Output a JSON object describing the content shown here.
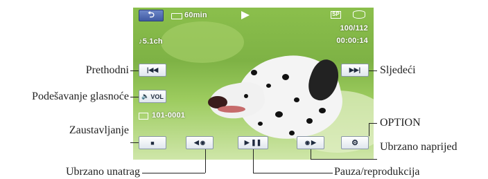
{
  "screen": {
    "battery": "60min",
    "quality_badge": "SP",
    "counter": "100/112",
    "timecode": "00:00:14",
    "audio": "♪5.1ch",
    "file_number": "101-0001",
    "icons": [
      "return-icon",
      "battery-icon",
      "play-indicator-icon",
      "quality-sp-icon",
      "media-hdd-icon",
      "folder-icon"
    ]
  },
  "buttons": {
    "return_label": "",
    "prev_label": "|◀◀",
    "next_label": "▶▶|",
    "volume_label": "VOL",
    "stop_label": "■",
    "rewind_label": "◀",
    "play_pause_label": "▶ ❚❚",
    "fast_forward_label": "▶",
    "option_label": ""
  },
  "labels": {
    "prev": "Prethodni",
    "next": "Sljedeći",
    "volume": "Podešavanje glasnoće",
    "stop": "Zaustavljanje",
    "option": "OPTION",
    "fast_forward": "Ubrzano naprijed",
    "rewind": "Ubrzano unatrag",
    "play_pause": "Pauza/reprodukcija"
  }
}
